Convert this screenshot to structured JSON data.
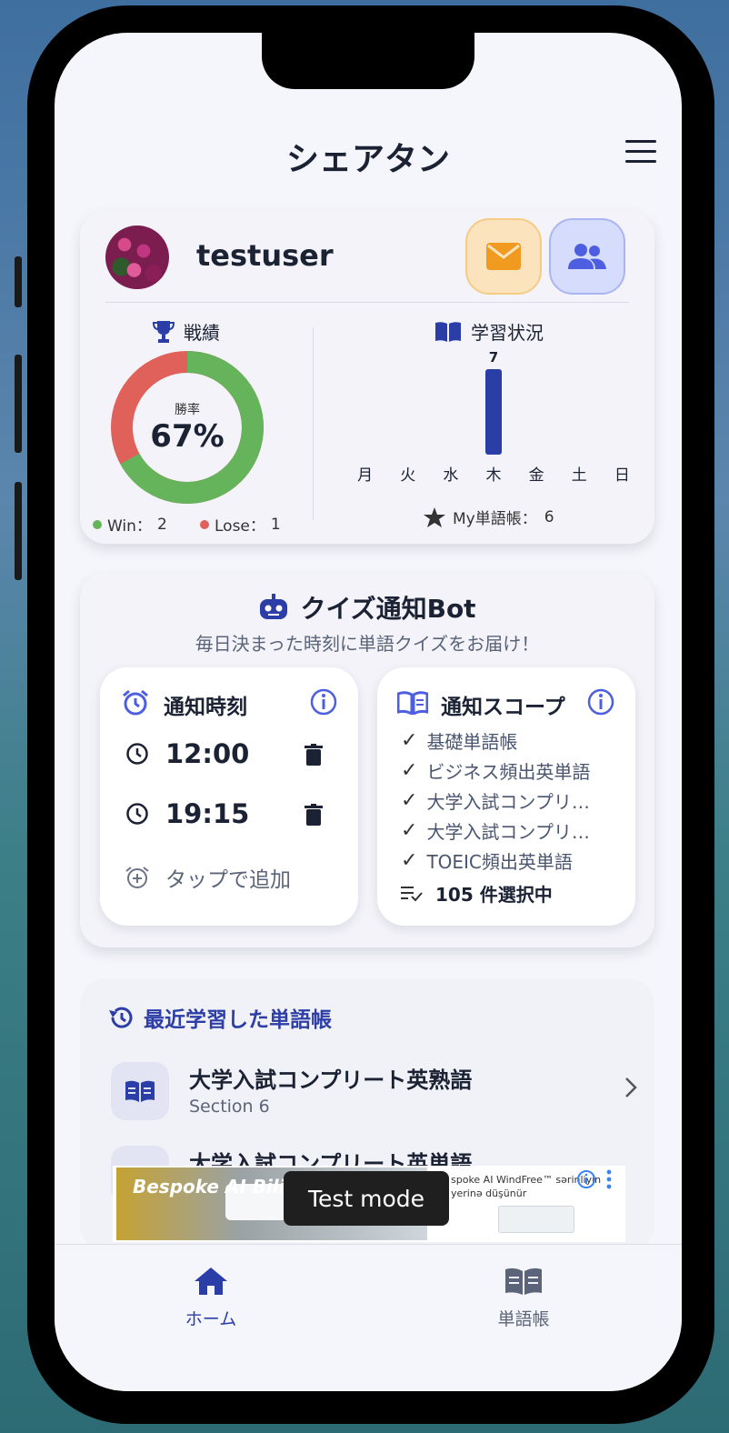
{
  "app": {
    "title": "シェアタン"
  },
  "profile": {
    "username": "testuser",
    "record": {
      "label": "戦績",
      "win_rate_label": "勝率",
      "win_rate_value": "67%",
      "win_fraction": 0.67,
      "win_label": "Win：",
      "win_count": "2",
      "lose_label": "Lose：",
      "lose_count": "1"
    },
    "study": {
      "label": "学習状況",
      "my_books_label": "My単語帳：",
      "my_books_count": "6"
    }
  },
  "chart_data": {
    "type": "bar",
    "categories": [
      "月",
      "火",
      "水",
      "木",
      "金",
      "土",
      "日"
    ],
    "values": [
      0,
      0,
      0,
      7,
      0,
      0,
      0
    ],
    "data_labels": [
      "",
      "",
      "",
      "7",
      "",
      "",
      ""
    ],
    "ylim": [
      0,
      7
    ],
    "grid": false,
    "color": "#2b3ea8"
  },
  "bot": {
    "title": "クイズ通知Bot",
    "subtitle": "毎日決まった時刻に単語クイズをお届け！",
    "time_card": {
      "title": "通知時刻",
      "times": [
        "12:00",
        "19:15"
      ],
      "add_label": "タップで追加"
    },
    "scope_card": {
      "title": "通知スコープ",
      "items": [
        "基礎単語帳",
        "ビジネス頻出英単語",
        "大学入試コンプリ…",
        "大学入試コンプリ…",
        "TOEIC頻出英単語"
      ],
      "selected_count": "105 件選択中"
    }
  },
  "recent": {
    "title": "最近学習した単語帳",
    "books": [
      {
        "name": "大学入試コンプリート英熟語",
        "section": "Section 6"
      },
      {
        "name": "大学入試コンプリート英単語",
        "section": ""
      }
    ]
  },
  "ad": {
    "brand": "Bespoke AI Bilir",
    "right_line1": "spoke AI WindFree™ sərinliyin",
    "right_line2": "yerinə düşünür",
    "toast": "Test mode"
  },
  "tabs": [
    {
      "label": "ホーム",
      "active": true
    },
    {
      "label": "単語帳",
      "active": false
    }
  ],
  "colors": {
    "accent": "#2b3ea8",
    "win": "#65b35a",
    "lose": "#e0605a",
    "mail_bg": "#fbe3bd",
    "friends_bg": "#d6dcfb"
  }
}
